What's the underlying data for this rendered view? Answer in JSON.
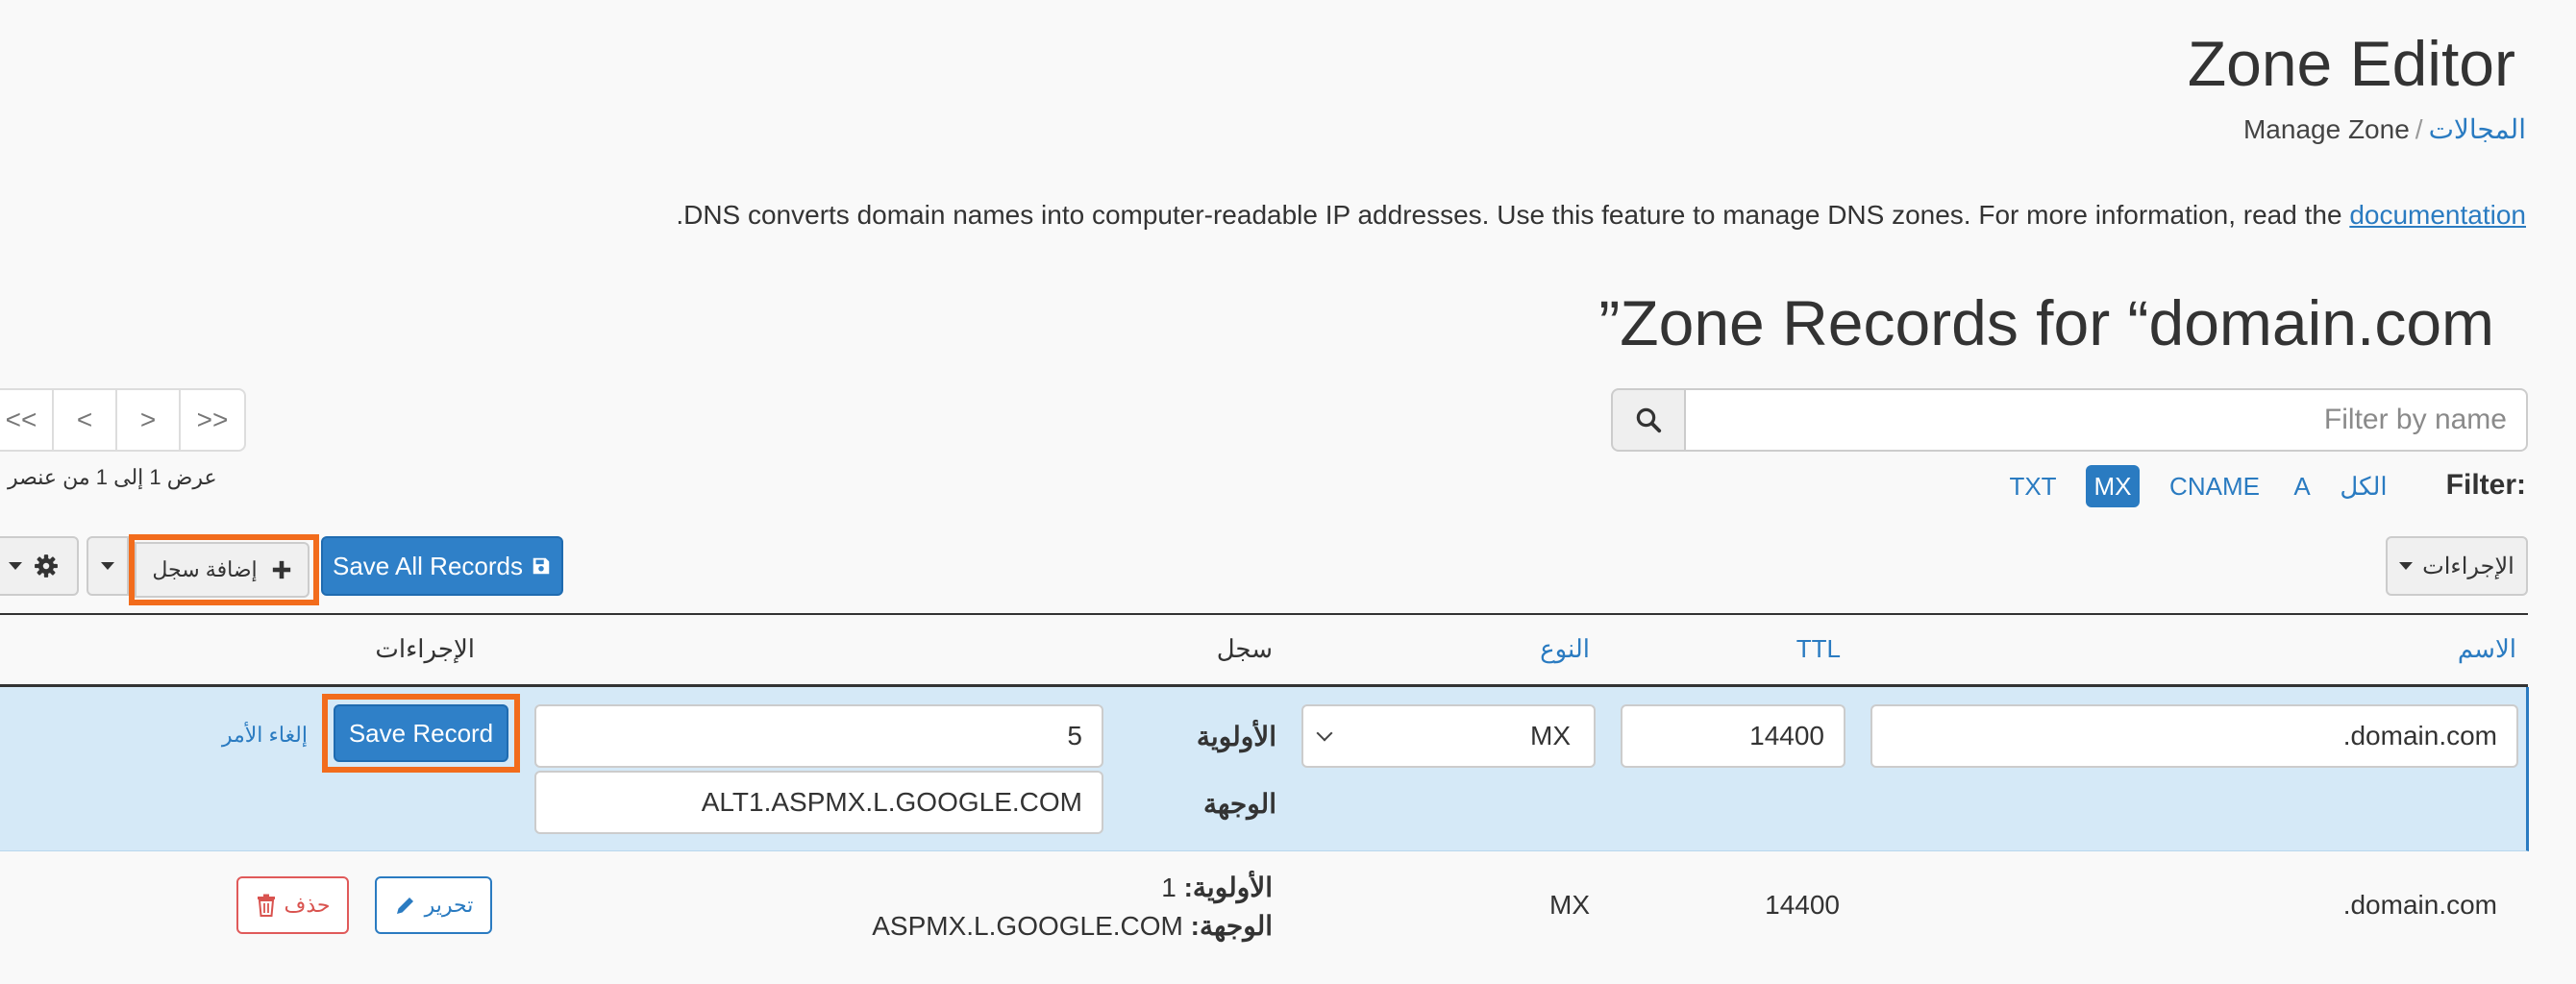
{
  "page": {
    "title": "Zone Editor",
    "breadcrumb": {
      "link": "المجالات",
      "separator": "/",
      "current": "Manage Zone"
    },
    "description": ".DNS converts domain names into computer-readable IP addresses. Use this feature to manage DNS zones. For more information, read the ",
    "documentation_link": "documentation"
  },
  "records": {
    "title": "”Zone Records for “domain.com",
    "search": {
      "placeholder": "Filter by name",
      "icon": "search-icon"
    },
    "pager": {
      "first": "<<",
      "prev": "<",
      "next": ">",
      "last": ">>"
    },
    "pager_info": "عرض 1 إلى 1 من عنصر",
    "filter": {
      "label": "Filter:",
      "options": [
        "الكل",
        "A",
        "CNAME",
        "MX",
        "TXT"
      ],
      "active": "MX"
    },
    "toolbar": {
      "actions_label": "الإجراءات",
      "save_all_label": "Save All Records",
      "add_record_label": "إضافة سجل",
      "gear_icon": "gear-icon"
    }
  },
  "table": {
    "headers": {
      "name": "الاسم",
      "ttl": "TTL",
      "type": "النوع",
      "record": "سجل",
      "actions": "الإجراءات"
    },
    "edit_row": {
      "name": ".domain.com",
      "ttl": "14400",
      "type": "MX",
      "priority_label": "الأولوية",
      "priority": "5",
      "destination_label": "الوجهة",
      "destination": "ALT1.ASPMX.L.GOOGLE.COM",
      "save_label": "Save Record",
      "cancel_label": "إلغاء الأمر"
    },
    "rows": [
      {
        "name": ".domain.com",
        "ttl": "14400",
        "type": "MX",
        "priority_label": "الأولوية:",
        "priority": "1",
        "destination_label": "الوجهة:",
        "destination": "ASPMX.L.GOOGLE.COM",
        "edit_label": "تحرير",
        "delete_label": "حذف"
      }
    ]
  },
  "colors": {
    "link": "#2a7bc1",
    "primary": "#2f80c8",
    "highlight": "#f26c1c",
    "edit_row_bg": "#d5e9f7",
    "danger": "#d9534f"
  }
}
